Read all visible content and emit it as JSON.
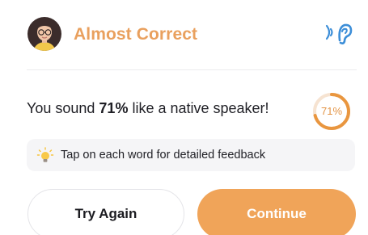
{
  "feedback": {
    "title": "Almost Correct",
    "listen_icon": "ear-sound-icon",
    "accent_color": "#e9a05e"
  },
  "score": {
    "prefix": "You sound ",
    "percent_text": "71%",
    "suffix": " like a native speaker!",
    "percent_value": 71,
    "ring_label": "71%"
  },
  "tip": {
    "icon": "lightbulb-icon",
    "text": "Tap on each word for detailed feedback"
  },
  "actions": {
    "try_again_label": "Try Again",
    "continue_label": "Continue",
    "continue_color": "#f0a459"
  }
}
